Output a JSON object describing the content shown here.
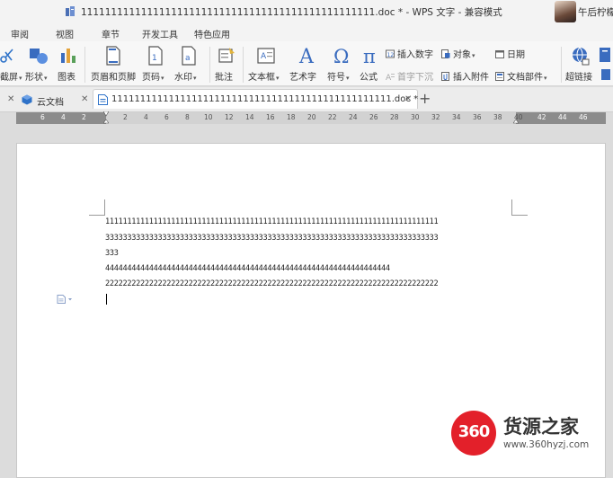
{
  "window": {
    "title": "1111111111111111111111111111111111111111111111111.doc * - WPS 文字 - 兼容模式",
    "user_name": "午后柠檬"
  },
  "menu": [
    "审阅",
    "视图",
    "章节",
    "开发工具",
    "特色应用"
  ],
  "ribbon": {
    "screenshot": "截屏",
    "shapes": "形状",
    "chart": "图表",
    "header_footer": "页眉和页脚",
    "page_number": "页码",
    "watermark": "水印",
    "comment": "批注",
    "textbox": "文本框",
    "wordart": "艺术字",
    "symbol": "符号",
    "formula": "公式",
    "insert_number": "插入数字",
    "object": "对象",
    "date": "日期",
    "drop_cap": "首字下沉",
    "insert_attachment": "插入附件",
    "doc_parts": "文档部件",
    "hyperlink": "超链接"
  },
  "tabs": {
    "cloud_docs": "云文档",
    "active_doc": "1111111111111111111111111111111111111111111111111.doc *"
  },
  "ruler": {
    "left_ticks": [
      "6",
      "4",
      "2"
    ],
    "ticks": [
      "2",
      "4",
      "6",
      "8",
      "10",
      "12",
      "14",
      "16",
      "18",
      "20",
      "22",
      "24",
      "26",
      "28",
      "30",
      "32",
      "34",
      "36",
      "38",
      "40"
    ],
    "right_ticks": [
      "42",
      "44",
      "46"
    ]
  },
  "document": {
    "lines": [
      "1111111111111111111111111111111111111111111111111111111111111111111111111111",
      "3333333333333333333333333333333333333333333333333333333333333333333333333333",
      "333",
      "44444444444444444444444444444444444444444444444444444444444444444",
      "2222222222222222222222222222222222222222222222222222222222222222222222222222"
    ]
  },
  "watermark": {
    "logo_text": "360",
    "brand": "货源之家",
    "url": "www.360hyzj.com"
  }
}
